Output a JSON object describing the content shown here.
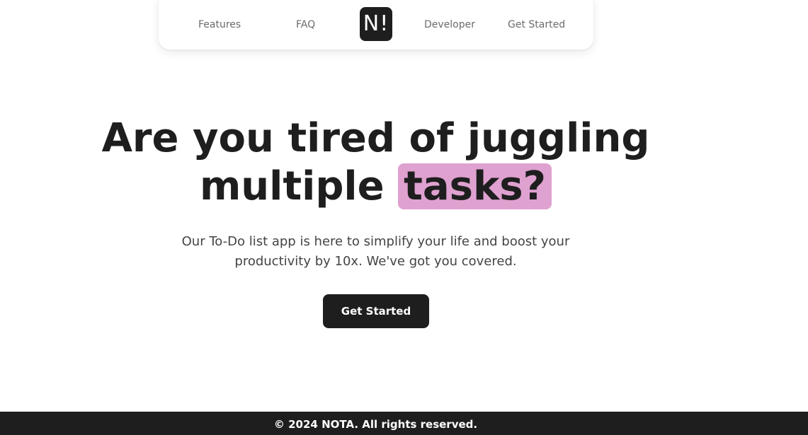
{
  "nav": {
    "features": "Features",
    "faq": "FAQ",
    "logo": "N!",
    "developer": "Developer",
    "get_started": "Get Started"
  },
  "hero": {
    "headline_line1": "Are you tired of juggling",
    "headline_line2_prefix": "multiple ",
    "headline_highlight": "tasks?",
    "subtext_line1": "Our To-Do list app is here to simplify your life and boost your",
    "subtext_line2": "productivity by 10x. We've got you covered.",
    "cta_label": "Get Started"
  },
  "footer": {
    "copyright": "© 2024 NOTA. All rights reserved."
  },
  "colors": {
    "dark": "#1e1e1e",
    "highlight": "#dfa1d0",
    "nav_text": "#6b6b6b",
    "body_text": "#444444"
  }
}
